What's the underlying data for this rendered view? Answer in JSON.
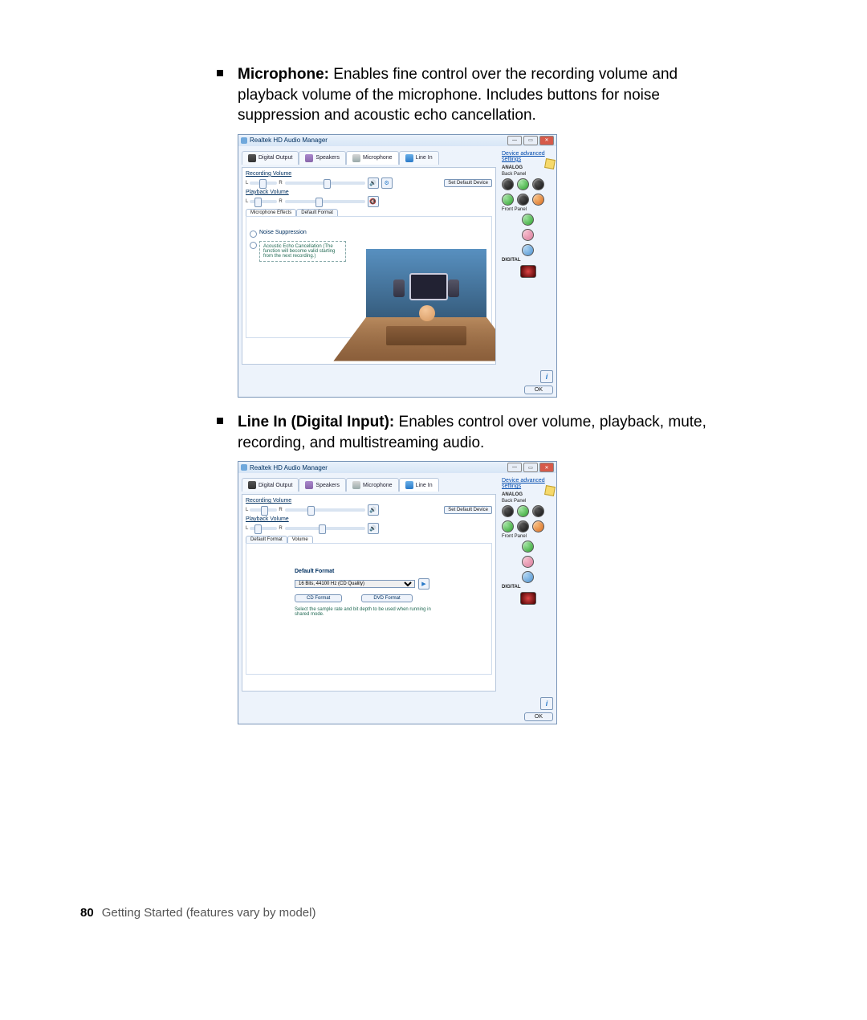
{
  "page": {
    "number": "80",
    "footer": "Getting Started (features vary by model)"
  },
  "bullets": {
    "mic": {
      "title": "Microphone:",
      "text": " Enables fine control over the recording volume and playback volume of the microphone. Includes buttons for noise suppression and acoustic echo cancellation."
    },
    "linein": {
      "title": "Line In (Digital Input):",
      "text": " Enables control over volume, playback, mute, recording, and multistreaming audio."
    }
  },
  "win": {
    "title": "Realtek HD Audio Manager",
    "adv_link": "Device advanced settings",
    "tabs": {
      "digital_output": "Digital Output",
      "speakers": "Speakers",
      "microphone": "Microphone",
      "line_in": "Line In"
    },
    "rec_vol": "Recording Volume",
    "play_vol": "Playback Volume",
    "set_default": "Set Default Device",
    "subtabs": {
      "fx": "Microphone Effects",
      "fmt": "Default Format",
      "vol": "Volume"
    },
    "noise_supp": "Noise Suppression",
    "echo": "Acoustic Echo Cancellation (The function will become valid starting from the next recording.)",
    "analog": "ANALOG",
    "back": "Back Panel",
    "front": "Front Panel",
    "digital": "DIGITAL",
    "ok": "OK",
    "df_title": "Default Format",
    "df_value": "16 Bits, 44100 Hz (CD Quality)",
    "cd": "CD Format",
    "dvd": "DVD Format",
    "df_hint": "Select the sample rate and bit depth to be used when running in shared mode."
  }
}
